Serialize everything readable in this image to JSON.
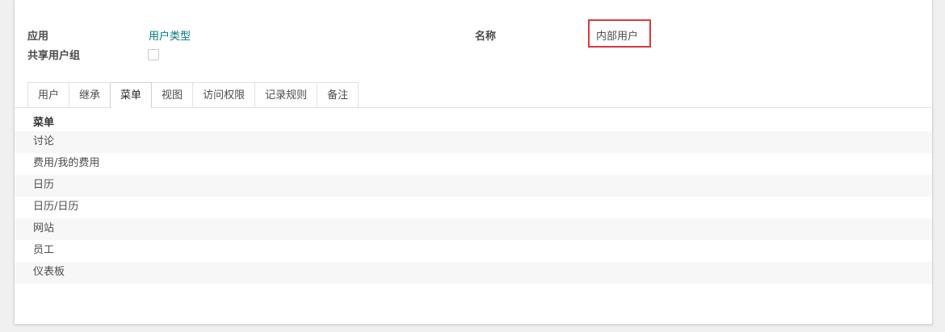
{
  "form": {
    "app_label": "应用",
    "app_value": "用户类型",
    "shared_group_label": "共享用户组",
    "name_label": "名称",
    "name_value": "内部用户"
  },
  "tabs": [
    {
      "label": "用户"
    },
    {
      "label": "继承"
    },
    {
      "label": "菜单"
    },
    {
      "label": "视图"
    },
    {
      "label": "访问权限"
    },
    {
      "label": "记录规则"
    },
    {
      "label": "备注"
    }
  ],
  "active_tab": "菜单",
  "menu_table": {
    "header": "菜单",
    "rows": [
      "讨论",
      "费用/我的费用",
      "日历",
      "日历/日历",
      "网站",
      "员工",
      "仪表板"
    ]
  },
  "colors": {
    "link": "#00787e",
    "highlight_box": "#e0363a"
  }
}
